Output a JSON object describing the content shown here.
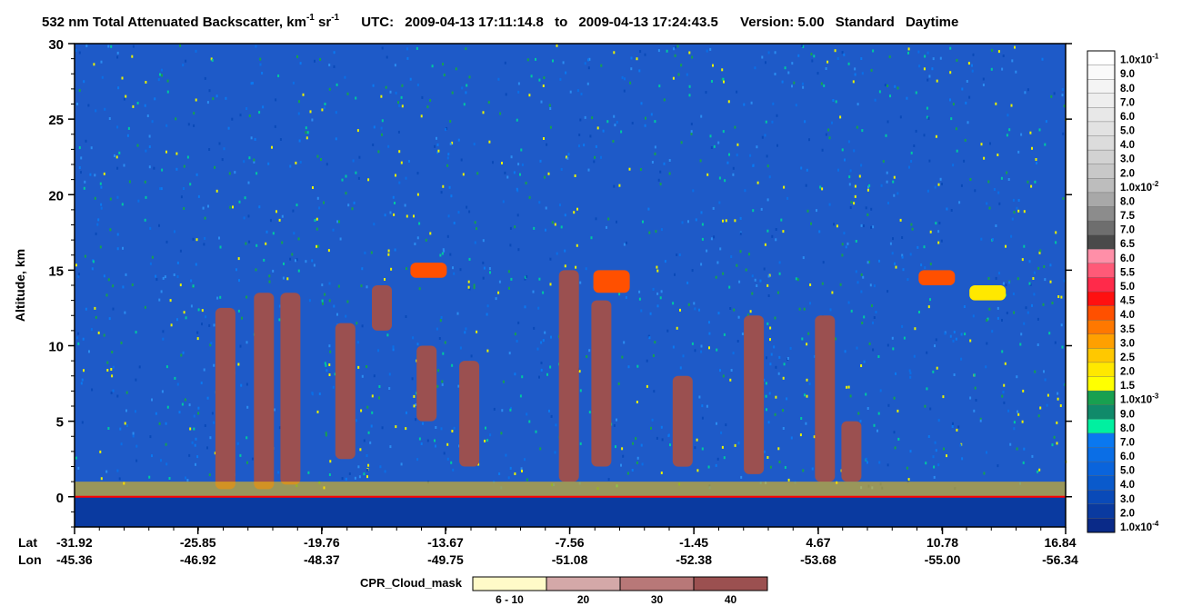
{
  "chart_data": {
    "type": "heatmap",
    "title": {
      "parts": [
        "532 nm Total Attenuated Backscatter, km",
        "-1",
        " sr",
        "-1"
      ],
      "utc_label": "UTC:",
      "start": "2009-04-13 17:11:14.8",
      "to": "to",
      "end": "2009-04-13 17:24:43.5",
      "version": "Version: 5.00",
      "product": "Standard",
      "daytime": "Daytime"
    },
    "ylabel": "Altitude, km",
    "ylim": [
      -2,
      30
    ],
    "yticks": [
      {
        "value": 0,
        "label": "0"
      },
      {
        "value": 5,
        "label": "5"
      },
      {
        "value": 10,
        "label": "10"
      },
      {
        "value": 15,
        "label": "15"
      },
      {
        "value": 20,
        "label": "20"
      },
      {
        "value": 25,
        "label": "25"
      },
      {
        "value": 30,
        "label": "30"
      }
    ],
    "x_axis": {
      "lat_label": "Lat",
      "lon_label": "Lon",
      "ticks": [
        {
          "lat": "-31.92",
          "lon": "-45.36"
        },
        {
          "lat": "-25.85",
          "lon": "-46.92"
        },
        {
          "lat": "-19.76",
          "lon": "-48.37"
        },
        {
          "lat": "-13.67",
          "lon": "-49.75"
        },
        {
          "lat": "-7.56",
          "lon": "-51.08"
        },
        {
          "lat": "-1.45",
          "lon": "-52.38"
        },
        {
          "lat": "4.67",
          "lon": "-53.68"
        },
        {
          "lat": "10.78",
          "lon": "-55.00"
        },
        {
          "lat": "16.84",
          "lon": "-56.34"
        }
      ]
    },
    "colorbar": [
      {
        "label": "1.0x10",
        "exp": "-1",
        "color": "#ffffff"
      },
      {
        "label": "9.0",
        "color": "#fafafa"
      },
      {
        "label": "8.0",
        "color": "#f4f4f4"
      },
      {
        "label": "7.0",
        "color": "#eeeeee"
      },
      {
        "label": "6.0",
        "color": "#e8e8e8"
      },
      {
        "label": "5.0",
        "color": "#e2e2e2"
      },
      {
        "label": "4.0",
        "color": "#dcdcdc"
      },
      {
        "label": "3.0",
        "color": "#d2d2d2"
      },
      {
        "label": "2.0",
        "color": "#c8c8c8"
      },
      {
        "label": "1.0x10",
        "exp": "-2",
        "color": "#bdbdbd"
      },
      {
        "label": "8.0",
        "color": "#a8a8a8"
      },
      {
        "label": "7.5",
        "color": "#8c8c8c"
      },
      {
        "label": "7.0",
        "color": "#6e6e6e"
      },
      {
        "label": "6.5",
        "color": "#4a4a4a"
      },
      {
        "label": "6.0",
        "color": "#ff8fa8"
      },
      {
        "label": "5.5",
        "color": "#ff5a78"
      },
      {
        "label": "5.0",
        "color": "#ff2a4a"
      },
      {
        "label": "4.5",
        "color": "#ff1010"
      },
      {
        "label": "4.0",
        "color": "#ff5000"
      },
      {
        "label": "3.5",
        "color": "#ff7800"
      },
      {
        "label": "3.0",
        "color": "#ffa000"
      },
      {
        "label": "2.5",
        "color": "#ffc800"
      },
      {
        "label": "2.0",
        "color": "#ffe800"
      },
      {
        "label": "1.5",
        "color": "#ffff00"
      },
      {
        "label": "1.0x10",
        "exp": "-3",
        "color": "#18a050"
      },
      {
        "label": "9.0",
        "color": "#108a6a"
      },
      {
        "label": "8.0",
        "color": "#00f0a0"
      },
      {
        "label": "7.0",
        "color": "#0a78f0"
      },
      {
        "label": "6.0",
        "color": "#0a6ee6"
      },
      {
        "label": "5.0",
        "color": "#0a64dc"
      },
      {
        "label": "4.0",
        "color": "#0a5acc"
      },
      {
        "label": "3.0",
        "color": "#0a4ab8"
      },
      {
        "label": "2.0",
        "color": "#0a3aa0"
      },
      {
        "label": "1.0x10",
        "exp": "-4",
        "color": "#0a2a88"
      }
    ],
    "cpr_legend": {
      "label": "CPR_Cloud_mask",
      "bins": [
        {
          "label": "6 - 10",
          "color": "#fffac8"
        },
        {
          "label": "20",
          "color": "#d4a8a8"
        },
        {
          "label": "30",
          "color": "#b87878"
        },
        {
          "label": "40",
          "color": "#9b5050"
        }
      ]
    },
    "colors": {
      "background_noise": "#1e5ac8",
      "cloud_mask": "#9b5050",
      "surface_line": "#ff0000",
      "below_surface": "#0a3aa0"
    },
    "cloud_features": [
      {
        "lat_center": -24.5,
        "base_km": 0.5,
        "top_km": 12.5,
        "kind": "cpr"
      },
      {
        "lat_center": -22.6,
        "base_km": 0.5,
        "top_km": 13.5,
        "kind": "cpr"
      },
      {
        "lat_center": -21.3,
        "base_km": 0.8,
        "top_km": 13.5,
        "kind": "cpr"
      },
      {
        "lat_center": -18.6,
        "base_km": 2.5,
        "top_km": 11.5,
        "kind": "cpr"
      },
      {
        "lat_center": -16.8,
        "base_km": 11.0,
        "top_km": 14.0,
        "kind": "cpr"
      },
      {
        "lat_center": -14.6,
        "base_km": 5.0,
        "top_km": 10.0,
        "kind": "cpr"
      },
      {
        "lat_center": -12.5,
        "base_km": 2.0,
        "top_km": 9.0,
        "kind": "cpr"
      },
      {
        "lat_center": -7.6,
        "base_km": 1.0,
        "top_km": 15.0,
        "kind": "cpr"
      },
      {
        "lat_center": -6.0,
        "base_km": 2.0,
        "top_km": 13.0,
        "kind": "cpr"
      },
      {
        "lat_center": -2.0,
        "base_km": 2.0,
        "top_km": 8.0,
        "kind": "cpr"
      },
      {
        "lat_center": 1.5,
        "base_km": 1.5,
        "top_km": 12.0,
        "kind": "cpr"
      },
      {
        "lat_center": 5.0,
        "base_km": 1.0,
        "top_km": 12.0,
        "kind": "cpr"
      },
      {
        "lat_center": 6.3,
        "base_km": 1.0,
        "top_km": 5.0,
        "kind": "cpr"
      },
      {
        "lat_center": -14.5,
        "base_km": 14.5,
        "top_km": 15.5,
        "kind": "strong"
      },
      {
        "lat_center": -5.5,
        "base_km": 13.5,
        "top_km": 15.0,
        "kind": "strong"
      },
      {
        "lat_center": 10.5,
        "base_km": 14.0,
        "top_km": 15.0,
        "kind": "strong"
      },
      {
        "lat_center": 13.0,
        "base_km": 13.0,
        "top_km": 14.0,
        "kind": "mid"
      }
    ]
  }
}
